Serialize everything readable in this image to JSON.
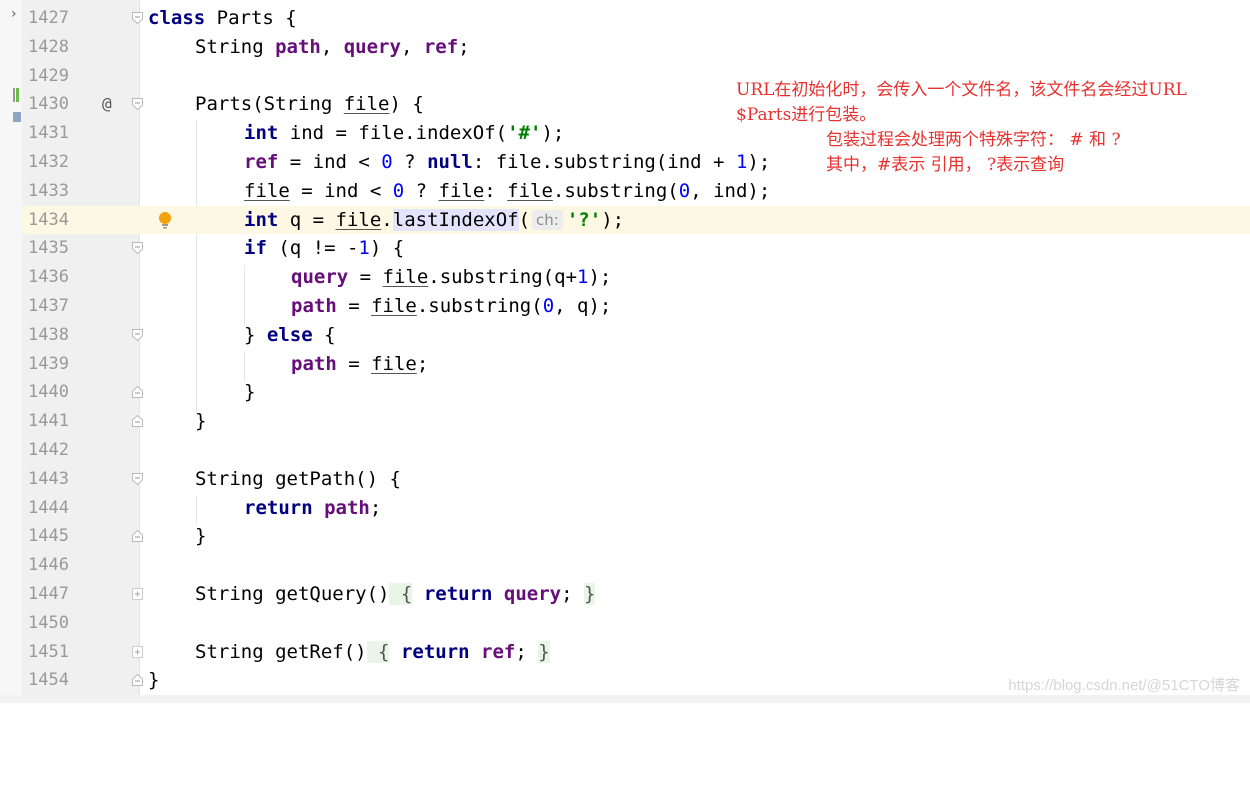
{
  "editor": {
    "lines": [
      {
        "num": "1427"
      },
      {
        "num": "1428"
      },
      {
        "num": "1429"
      },
      {
        "num": "1430",
        "annotation": "@"
      },
      {
        "num": "1431"
      },
      {
        "num": "1432"
      },
      {
        "num": "1433"
      },
      {
        "num": "1434",
        "current": true
      },
      {
        "num": "1435"
      },
      {
        "num": "1436"
      },
      {
        "num": "1437"
      },
      {
        "num": "1438"
      },
      {
        "num": "1439"
      },
      {
        "num": "1440"
      },
      {
        "num": "1441"
      },
      {
        "num": "1442"
      },
      {
        "num": "1443"
      },
      {
        "num": "1444"
      },
      {
        "num": "1445"
      },
      {
        "num": "1446"
      },
      {
        "num": "1447"
      },
      {
        "num": "1450"
      },
      {
        "num": "1451"
      },
      {
        "num": "1454"
      }
    ],
    "code": {
      "l1427": [
        "class",
        " Parts {"
      ],
      "l1428": [
        "String ",
        "path",
        ", ",
        "query",
        ", ",
        "ref",
        ";"
      ],
      "l1430": [
        "Parts(String ",
        "file",
        ") {"
      ],
      "l1431": [
        "int",
        " ind = file.indexOf(",
        "'#'",
        ");"
      ],
      "l1432": [
        "ref",
        " = ind < ",
        "0",
        " ? ",
        "null",
        ": file.substring(ind + ",
        "1",
        ");"
      ],
      "l1433": [
        "file",
        " = ind < ",
        "0",
        " ? ",
        "file",
        ": ",
        "file",
        ".substring(",
        "0",
        ", ind);"
      ],
      "l1434": [
        "int",
        " q = ",
        "file",
        ".",
        "lastIndexOf",
        "(",
        "ch:",
        "'?'",
        ");"
      ],
      "l1435": [
        "if",
        " (q != -",
        "1",
        ") {"
      ],
      "l1436": [
        "query",
        " = ",
        "file",
        ".substring(q+",
        "1",
        ");"
      ],
      "l1437": [
        "path",
        " = ",
        "file",
        ".substring(",
        "0",
        ", q);"
      ],
      "l1438": [
        "} ",
        "else",
        " {"
      ],
      "l1439": [
        "path",
        " = ",
        "file",
        ";"
      ],
      "l1440": [
        "}"
      ],
      "l1441": [
        "}"
      ],
      "l1443": [
        "String getPath() {"
      ],
      "l1444": [
        "return",
        " ",
        "path",
        ";"
      ],
      "l1445": [
        "}"
      ],
      "l1447": [
        "String getQuery()",
        " {",
        " ",
        "return",
        " ",
        "query",
        "; ",
        "}"
      ],
      "l1451": [
        "String getRef()",
        " {",
        " ",
        "return",
        " ",
        "ref",
        "; ",
        "}"
      ],
      "l1454": [
        "}"
      ]
    }
  },
  "annotation_comment": {
    "line1": "URL在初始化时，会传入一个文件名，该文件名会经过URL",
    "line2": "$Parts进行包装。",
    "line3": "包装过程会处理两个特殊字符： # 和 ?",
    "line4": "其中，#表示 引用， ?表示查询"
  },
  "watermark": "https://blog.csdn.net/@51CTO博客",
  "colors": {
    "keyword": "#000080",
    "field": "#660e7a",
    "number": "#0000ff",
    "string": "#008000",
    "comment_red": "#e6312f",
    "current_line": "#fdf8e3"
  }
}
